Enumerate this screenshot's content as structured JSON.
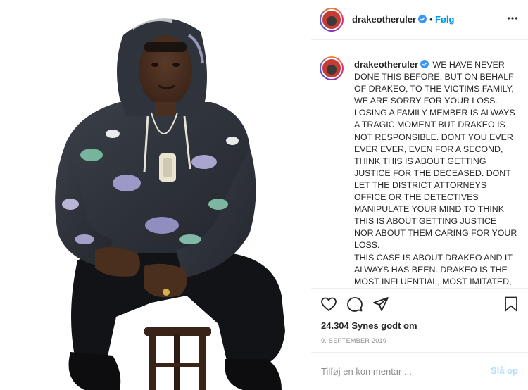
{
  "post": {
    "username": "drakeotheruler",
    "verified": true,
    "separator": "•",
    "follow_label": "Følg",
    "more_icon": "more-options-icon",
    "caption_text": "WE HAVE NEVER DONE THIS BEFORE, BUT ON BEHALF OF DRAKEO, TO THE VICTIMS FAMILY, WE ARE SORRY FOR YOUR LOSS. LOSING A FAMILY MEMBER IS ALWAYS A TRAGIC MOMENT BUT DRAKEO IS NOT RESPONSIBLE. DONT YOU EVER EVER EVER, EVEN FOR A SECOND, THINK THIS IS ABOUT GETTING JUSTICE FOR THE DECEASED. DONT LET THE DISTRICT ATTORNEYS OFFICE OR THE DETECTIVES MANIPULATE YOUR MIND TO THINK THIS IS ABOUT GETTING JUSTICE NOR ABOUT THEM CARING FOR YOUR LOSS.",
    "caption_text_2": "THIS CASE IS ABOUT DRAKEO AND IT ALWAYS HAS BEEN. DRAKEO IS THE MOST INFLUENTIAL, MOST IMITATED, AND MOST ORIGINAL ARTIST TO EVER COME OUTTA LA. DRAKEO HAS",
    "likes": "24.304 Synes godt om",
    "date": "9. SEPTEMBER 2019"
  },
  "actions": {
    "like_icon": "heart-icon",
    "comment_icon": "comment-icon",
    "share_icon": "send-icon",
    "save_icon": "bookmark-icon"
  },
  "comment": {
    "placeholder": "Tilføj en kommentar ...",
    "post_label": "Slå op"
  },
  "colors": {
    "accent": "#0095f6",
    "post_disabled": "#b2dffc",
    "verified": "#3897f0",
    "text": "#262626",
    "muted": "#8e8e8e",
    "border": "#efefef"
  }
}
